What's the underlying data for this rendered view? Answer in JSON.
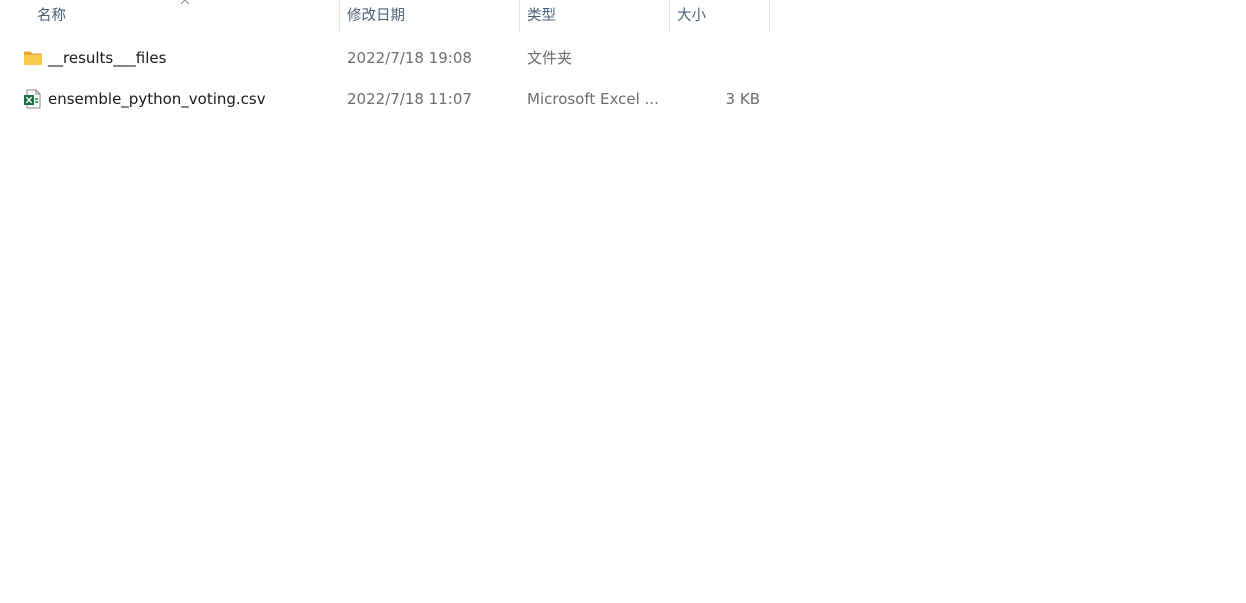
{
  "columns": {
    "name": "名称",
    "date": "修改日期",
    "type": "类型",
    "size": "大小"
  },
  "sort": {
    "column": "name",
    "direction": "ascending",
    "icon": "chevron-up-icon"
  },
  "files": [
    {
      "icon": "folder-icon",
      "name": "__results___files",
      "date": "2022/7/18 19:08",
      "type": "文件夹",
      "size": ""
    },
    {
      "icon": "excel-csv-icon",
      "name": "ensemble_python_voting.csv",
      "date": "2022/7/18 11:07",
      "type": "Microsoft Excel ...",
      "size": "3 KB"
    }
  ],
  "colors": {
    "header_text": "#4c607a",
    "secondary_text": "#6d6d6d",
    "folder": "#f8c94a",
    "excel": "#1d7044"
  }
}
